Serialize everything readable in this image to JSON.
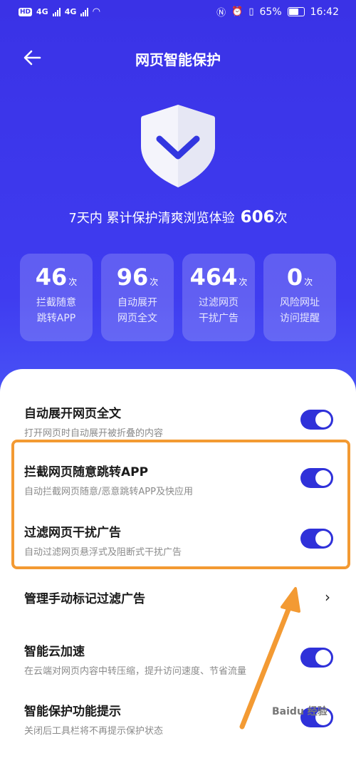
{
  "status_bar": {
    "left_chip": "HD",
    "network_a": "4G",
    "network_b": "4G",
    "battery": "65%",
    "time": "16:42"
  },
  "header": {
    "title": "网页智能保护"
  },
  "summary": {
    "text": "7天内 累计保护清爽浏览体验",
    "count": "606",
    "unit": "次"
  },
  "stats": [
    {
      "value": "46",
      "unit": "次",
      "label": "拦截随意\n跳转APP"
    },
    {
      "value": "96",
      "unit": "次",
      "label": "自动展开\n网页全文"
    },
    {
      "value": "464",
      "unit": "次",
      "label": "过滤网页\n干扰广告"
    },
    {
      "value": "0",
      "unit": "次",
      "label": "风险网址\n访问提醒"
    }
  ],
  "settings": [
    {
      "title": "自动展开网页全文",
      "subtitle": "打开网页时自动展开被折叠的内容",
      "enabled": true
    },
    {
      "title": "拦截网页随意跳转APP",
      "subtitle": "自动拦截网页随意/恶意跳转APP及快应用",
      "enabled": true
    },
    {
      "title": "过滤网页干扰广告",
      "subtitle": "自动过滤网页悬浮式及阻断式干扰广告",
      "enabled": true
    },
    {
      "title": "管理手动标记过滤广告",
      "chevron": "›"
    },
    {
      "title": "智能云加速",
      "subtitle": "在云端对网页内容中转压缩，提升访问速度、节省流量",
      "enabled": true
    },
    {
      "title": "智能保护功能提示",
      "subtitle": "关闭后工具栏将不再提示保护状态",
      "enabled": true
    }
  ],
  "colors": {
    "accent": "#2f31d9",
    "highlight": "#f39a33",
    "background_top": "#3a32e6"
  },
  "watermark": "Baidu 经验"
}
